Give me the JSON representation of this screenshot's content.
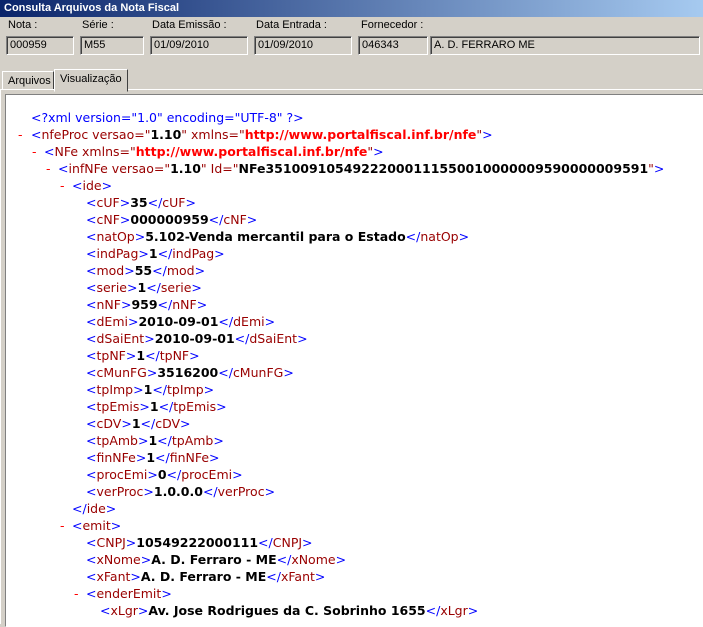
{
  "window": {
    "title": "Consulta Arquivos da Nota Fiscal"
  },
  "header": {
    "nota": {
      "label": "Nota :",
      "value": "000959"
    },
    "serie": {
      "label": "Série :",
      "value": "M55"
    },
    "emissao": {
      "label": "Data Emissão :",
      "value": "01/09/2010"
    },
    "entrada": {
      "label": "Data Entrada :",
      "value": "01/09/2010"
    },
    "fornecedor": {
      "label": "Fornecedor :",
      "code": "046343",
      "name": "A. D. FERRARO ME"
    }
  },
  "tabs": [
    {
      "label": "Arquivos"
    },
    {
      "label": "Visualização"
    }
  ],
  "xml": {
    "decl": "<?xml version=\"1.0\" encoding=\"UTF-8\" ?>",
    "nfeproc_open": "<nfeProc",
    "nfeproc_attr1": " versao=\"",
    "nfeproc_ver": "1.10",
    "nfeproc_attr2": "\" xmlns=\"",
    "nfeproc_ns": "http://www.portalfiscal.inf.br/nfe",
    "nfeproc_close": "\">",
    "nfe_open": "<NFe xmlns=\"",
    "nfe_ns": "http://www.portalfiscal.inf.br/nfe",
    "nfe_close": "\">",
    "inf_open": "<infNFe versao=\"",
    "inf_ver": "1.10",
    "inf_mid": "\" Id=\"",
    "inf_id": "NFe35100910549222000111550010000009590000009591",
    "inf_close": "\">",
    "ide_open": "<ide>",
    "ide_close": "</ide>",
    "ide_fields": [
      {
        "tag": "cUF",
        "value": "35"
      },
      {
        "tag": "cNF",
        "value": "000000959"
      },
      {
        "tag": "natOp",
        "value": "5.102-Venda mercantil para o Estado"
      },
      {
        "tag": "indPag",
        "value": "1"
      },
      {
        "tag": "mod",
        "value": "55"
      },
      {
        "tag": "serie",
        "value": "1"
      },
      {
        "tag": "nNF",
        "value": "959"
      },
      {
        "tag": "dEmi",
        "value": "2010-09-01"
      },
      {
        "tag": "dSaiEnt",
        "value": "2010-09-01"
      },
      {
        "tag": "tpNF",
        "value": "1"
      },
      {
        "tag": "cMunFG",
        "value": "3516200"
      },
      {
        "tag": "tpImp",
        "value": "1"
      },
      {
        "tag": "tpEmis",
        "value": "1"
      },
      {
        "tag": "cDV",
        "value": "1"
      },
      {
        "tag": "tpAmb",
        "value": "1"
      },
      {
        "tag": "finNFe",
        "value": "1"
      },
      {
        "tag": "procEmi",
        "value": "0"
      },
      {
        "tag": "verProc",
        "value": "1.0.0.0"
      }
    ],
    "emit_open": "<emit>",
    "emit_fields": [
      {
        "tag": "CNPJ",
        "value": "10549222000111"
      },
      {
        "tag": "xNome",
        "value": "A. D. Ferraro - ME"
      },
      {
        "tag": "xFant",
        "value": "A. D. Ferraro - ME"
      }
    ],
    "ender_open": "<enderEmit>",
    "ender_fields": [
      {
        "tag": "xLgr",
        "value": "Av. Jose Rodrigues da C. Sobrinho 1655"
      }
    ],
    "collapse_marker": "-"
  }
}
